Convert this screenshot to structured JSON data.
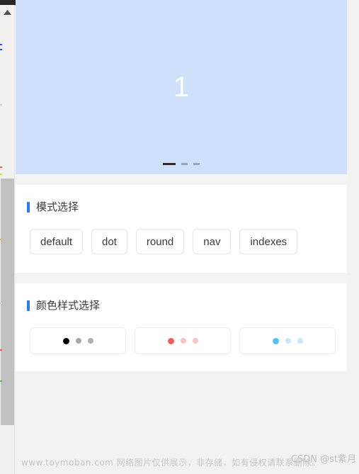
{
  "window": {
    "scrollbar": {
      "up_arrow_icon": "triangle-up-icon",
      "thumb_label": "vertical-scroll-thumb"
    }
  },
  "carousel": {
    "slide_label": "1",
    "background_color": "#cfe0fa",
    "indicators": [
      {
        "state": "active",
        "color": "#2d2d2d"
      },
      {
        "state": "idle",
        "color": "#9aa7bb"
      },
      {
        "state": "idle",
        "color": "#9aa7bb"
      }
    ]
  },
  "sections": [
    {
      "title": "模式选择",
      "accent_color": "#2979ff",
      "buttons": [
        {
          "label": "default"
        },
        {
          "label": "dot"
        },
        {
          "label": "round"
        },
        {
          "label": "nav"
        },
        {
          "label": "indexes"
        }
      ]
    },
    {
      "title": "颜色样式选择",
      "accent_color": "#2979ff",
      "swatches": [
        {
          "name": "black-style",
          "dots": [
            "#000000",
            "#a8a8a8",
            "#b0b0b0"
          ]
        },
        {
          "name": "red-style",
          "dots": [
            "#fc5a5a",
            "#ffc0c0",
            "#ffc4c8"
          ]
        },
        {
          "name": "blue-style",
          "dots": [
            "#4dc3fa",
            "#c4e9fb",
            "#c6e8fa"
          ]
        }
      ]
    }
  ],
  "watermark": {
    "left_text": "www.toymoban.com 网络图片仅供展示，非存储，如有侵权请联系删除。",
    "right_text": "CSDN @st紫月"
  }
}
